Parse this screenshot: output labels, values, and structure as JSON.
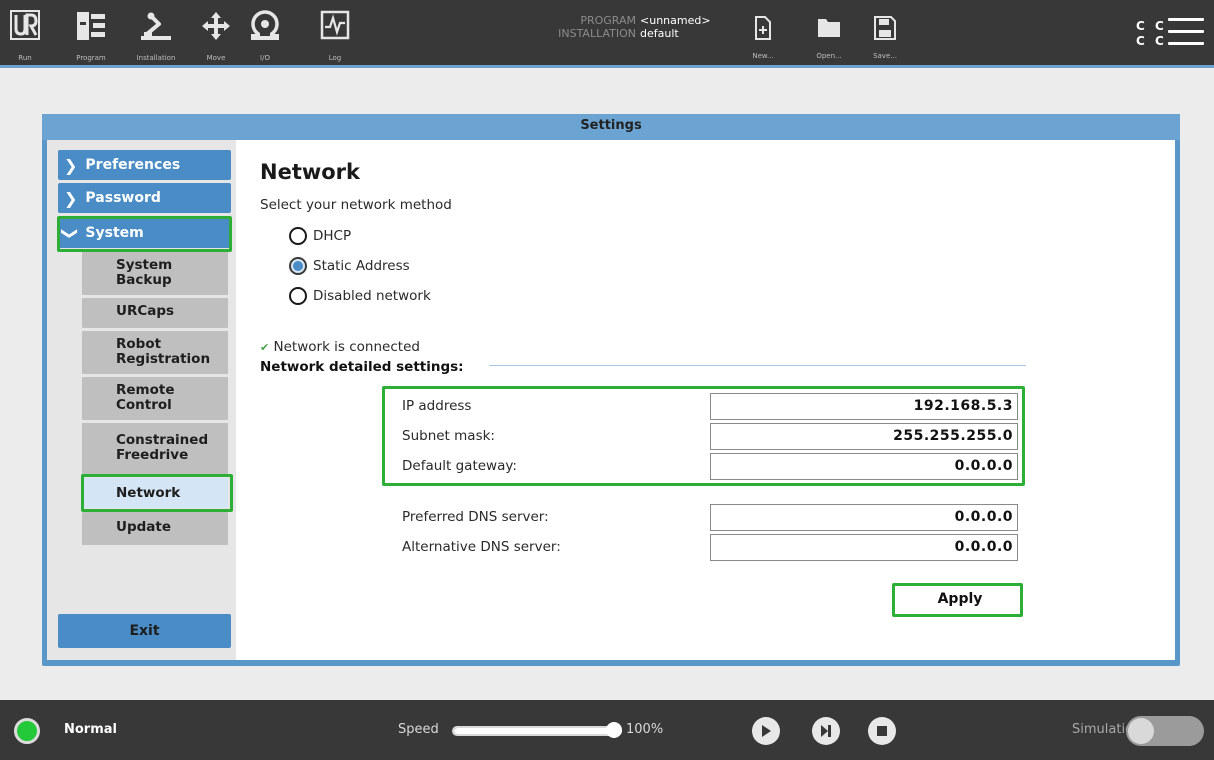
{
  "topbar": {
    "nav": [
      {
        "label": "Run",
        "icon": "ur-logo-icon"
      },
      {
        "label": "Program",
        "icon": "program-icon"
      },
      {
        "label": "Installation",
        "icon": "installation-icon"
      },
      {
        "label": "Move",
        "icon": "move-icon"
      },
      {
        "label": "I/O",
        "icon": "io-icon"
      },
      {
        "label": "Log",
        "icon": "log-icon"
      }
    ],
    "program_key": "PROGRAM",
    "program_value": "<unnamed>",
    "installation_key": "INSTALLATION",
    "installation_value": "default",
    "file_ops": [
      {
        "label": "New...",
        "icon": "new-file-icon"
      },
      {
        "label": "Open...",
        "icon": "folder-icon"
      },
      {
        "label": "Save...",
        "icon": "save-icon"
      }
    ],
    "cc_row1": "C C",
    "cc_row2": "C C",
    "menu_icon": "hamburger-menu-icon"
  },
  "settings": {
    "title": "Settings",
    "sidebar": {
      "items": [
        {
          "label": "Preferences",
          "expanded": false
        },
        {
          "label": "Password",
          "expanded": false
        },
        {
          "label": "System",
          "expanded": true
        }
      ],
      "sub_items": [
        {
          "label": "System Backup"
        },
        {
          "label": "URCaps"
        },
        {
          "label": "Robot Registration"
        },
        {
          "label": "Remote Control"
        },
        {
          "label": "Constrained Freedrive"
        },
        {
          "label": "Network",
          "selected": true
        },
        {
          "label": "Update"
        }
      ],
      "exit_label": "Exit"
    },
    "network": {
      "title": "Network",
      "method_prompt": "Select your network method",
      "options": [
        {
          "label": "DHCP",
          "selected": false
        },
        {
          "label": "Static Address",
          "selected": true
        },
        {
          "label": "Disabled network",
          "selected": false
        }
      ],
      "status": "Network is connected",
      "details_heading": "Network detailed settings:",
      "fields": [
        {
          "label": "IP address",
          "value": "192.168.5.3"
        },
        {
          "label": "Subnet mask:",
          "value": "255.255.255.0"
        },
        {
          "label": "Default gateway:",
          "value": "0.0.0.0"
        },
        {
          "label": "Preferred DNS server:",
          "value": "0.0.0.0"
        },
        {
          "label": "Alternative DNS server:",
          "value": "0.0.0.0"
        }
      ],
      "apply_label": "Apply"
    }
  },
  "footer": {
    "status": "Normal",
    "status_color": "#24c93a",
    "speed_label": "Speed",
    "speed_value": "100%",
    "speed_fraction": 1.0,
    "controls": [
      "play-icon",
      "step-icon",
      "stop-icon"
    ],
    "simulation_label": "Simulation",
    "simulation_on": false
  },
  "colors": {
    "accent": "#4a8cc6",
    "highlight": "#2cae37",
    "topbar": "#383838"
  }
}
